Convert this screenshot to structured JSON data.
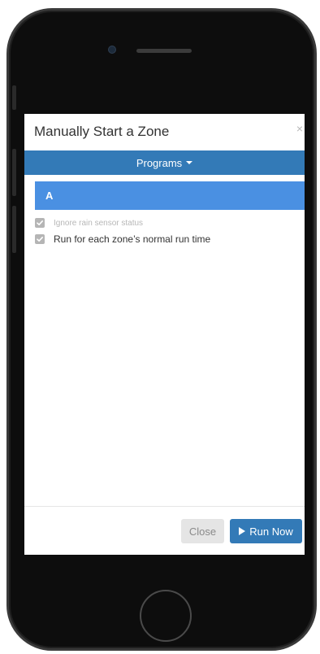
{
  "dialog": {
    "title": "Manually Start a Zone",
    "close_symbol": "×"
  },
  "programs_menu": {
    "label": "Programs",
    "icon": "chevron-down-icon"
  },
  "programs": [
    {
      "label": "A",
      "selected": true
    }
  ],
  "options": [
    {
      "label": "Ignore rain sensor status",
      "checked": true,
      "muted": true
    },
    {
      "label": "Run for each zone’s normal run time",
      "checked": true,
      "muted": false
    }
  ],
  "footer": {
    "close_label": "Close",
    "run_label": "Run Now",
    "run_icon": "play-icon"
  },
  "colors": {
    "primary": "#337ab7",
    "selected_item": "#4a90e2",
    "phone_body": "#0d0d0d"
  }
}
